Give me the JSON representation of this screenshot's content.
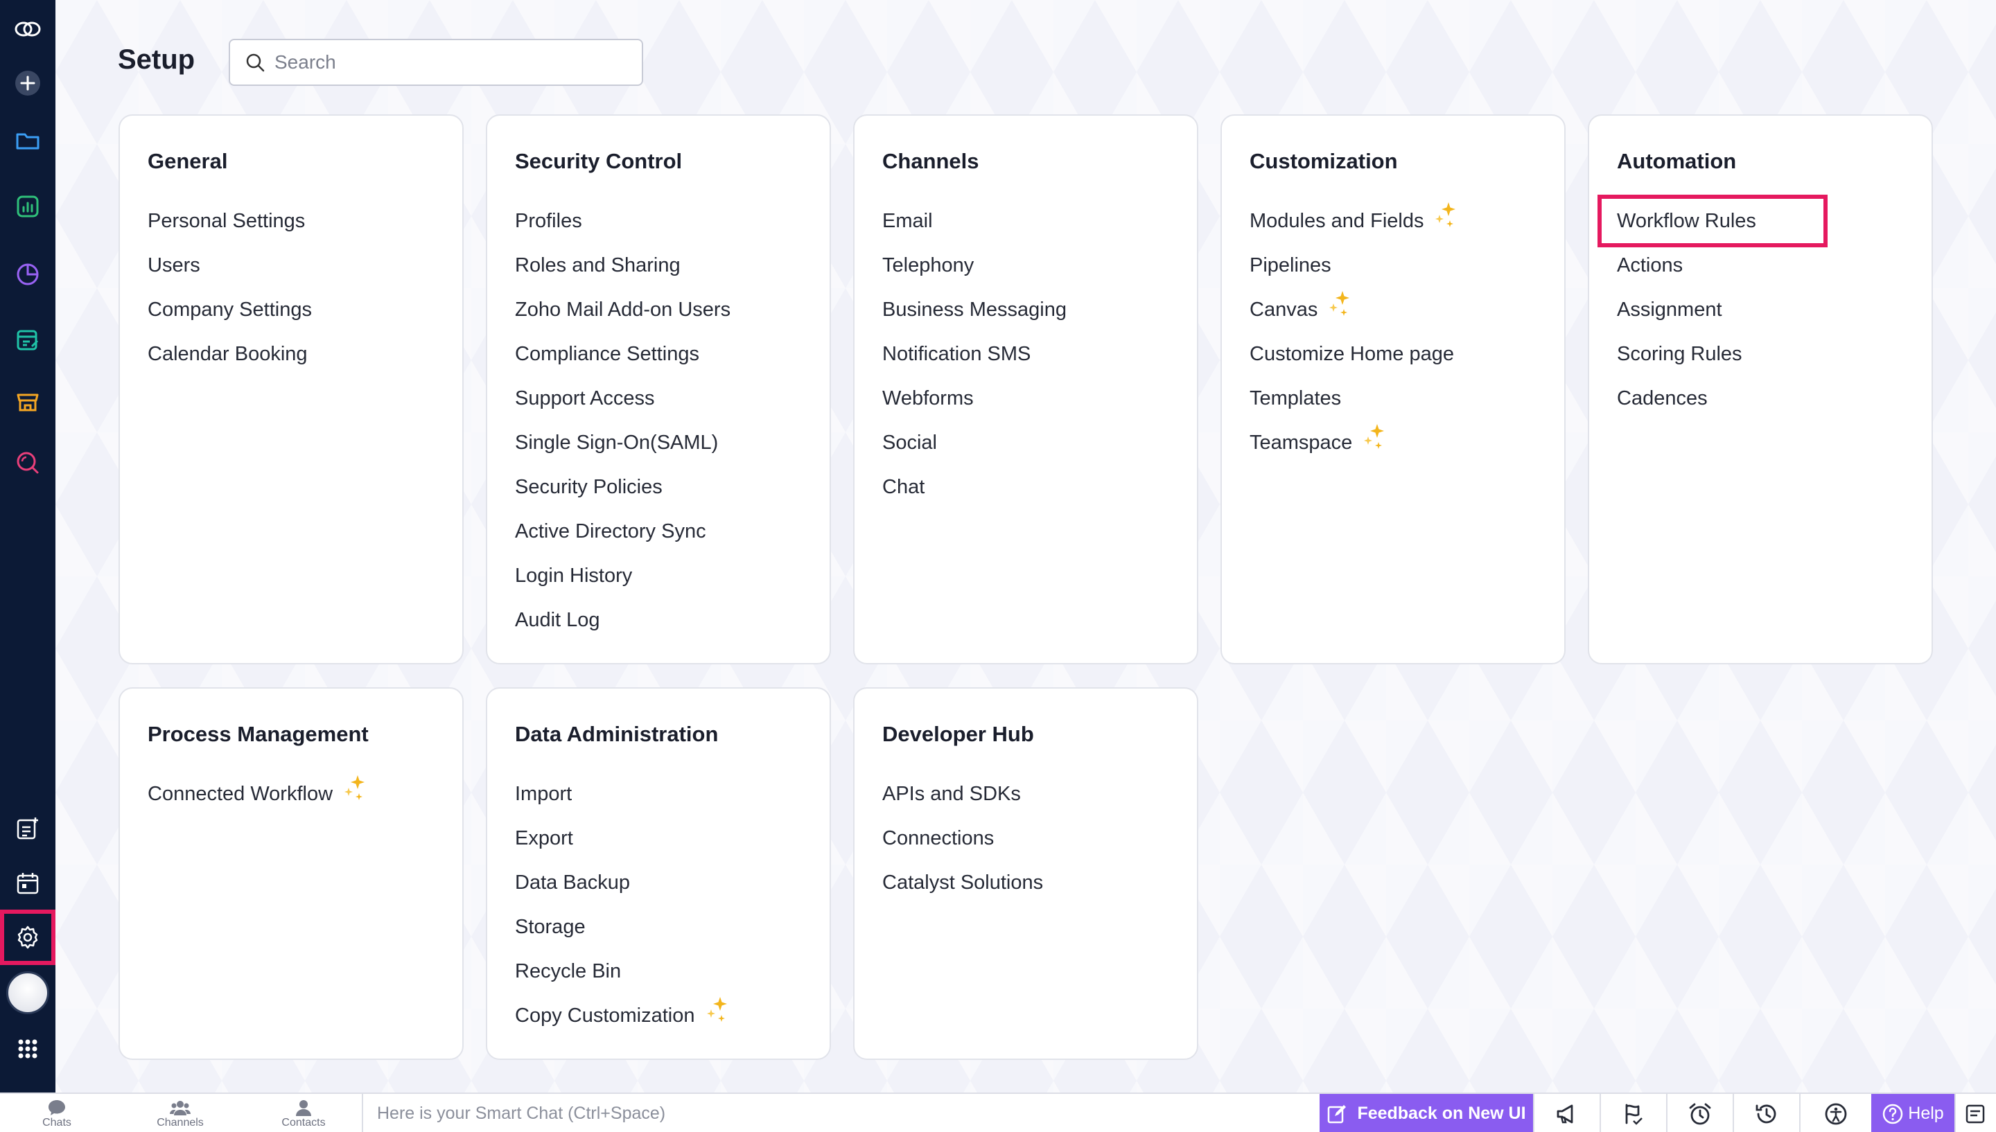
{
  "page": {
    "title": "Setup",
    "search_placeholder": "Search"
  },
  "rail": {
    "icons": [
      "zoho-logo-icon",
      "add-icon",
      "folder-icon",
      "reports-icon",
      "analytics-icon",
      "checklist-icon",
      "marketplace-icon",
      "search-icon",
      "add-note-icon",
      "calendar-icon",
      "settings-icon",
      "avatar",
      "app-grid-icon"
    ],
    "active": "settings-icon"
  },
  "cards": [
    {
      "title": "General",
      "items": [
        {
          "label": "Personal Settings"
        },
        {
          "label": "Users"
        },
        {
          "label": "Company Settings"
        },
        {
          "label": "Calendar Booking"
        }
      ]
    },
    {
      "title": "Security Control",
      "items": [
        {
          "label": "Profiles"
        },
        {
          "label": "Roles and Sharing"
        },
        {
          "label": "Zoho Mail Add-on Users"
        },
        {
          "label": "Compliance Settings"
        },
        {
          "label": "Support Access"
        },
        {
          "label": "Single Sign-On(SAML)"
        },
        {
          "label": "Security Policies"
        },
        {
          "label": "Active Directory Sync"
        },
        {
          "label": "Login History"
        },
        {
          "label": "Audit Log"
        }
      ]
    },
    {
      "title": "Channels",
      "items": [
        {
          "label": "Email"
        },
        {
          "label": "Telephony"
        },
        {
          "label": "Business Messaging"
        },
        {
          "label": "Notification SMS"
        },
        {
          "label": "Webforms"
        },
        {
          "label": "Social"
        },
        {
          "label": "Chat"
        }
      ]
    },
    {
      "title": "Customization",
      "items": [
        {
          "label": "Modules and Fields",
          "sparkle": true
        },
        {
          "label": "Pipelines"
        },
        {
          "label": "Canvas",
          "sparkle": true
        },
        {
          "label": "Customize Home page"
        },
        {
          "label": "Templates"
        },
        {
          "label": "Teamspace",
          "sparkle": true
        }
      ]
    },
    {
      "title": "Automation",
      "items": [
        {
          "label": "Workflow Rules",
          "highlighted": true
        },
        {
          "label": "Actions"
        },
        {
          "label": "Assignment"
        },
        {
          "label": "Scoring Rules"
        },
        {
          "label": "Cadences"
        }
      ]
    },
    {
      "title": "Process Management",
      "items": [
        {
          "label": "Connected Workflow",
          "sparkle": true
        }
      ]
    },
    {
      "title": "Data Administration",
      "items": [
        {
          "label": "Import"
        },
        {
          "label": "Export"
        },
        {
          "label": "Data Backup"
        },
        {
          "label": "Storage"
        },
        {
          "label": "Recycle Bin"
        },
        {
          "label": "Copy Customization",
          "sparkle": true
        }
      ]
    },
    {
      "title": "Developer Hub",
      "items": [
        {
          "label": "APIs and SDKs"
        },
        {
          "label": "Connections"
        },
        {
          "label": "Catalyst Solutions"
        }
      ]
    }
  ],
  "bottombar": {
    "tabs": [
      {
        "label": "Chats"
      },
      {
        "label": "Channels"
      },
      {
        "label": "Contacts"
      }
    ],
    "smart_chat_placeholder": "Here is your Smart Chat (Ctrl+Space)",
    "feedback_label": "Feedback on New UI",
    "icons": [
      "announcement-icon",
      "tour-icon",
      "alarm-icon",
      "history-icon",
      "accessibility-icon"
    ],
    "help_label": "Help"
  },
  "colors": {
    "rail_bg": "#0c1a36",
    "highlight": "#e5195f",
    "accent_purple": "#8a5cf0",
    "sparkle": "#f3b51c"
  }
}
